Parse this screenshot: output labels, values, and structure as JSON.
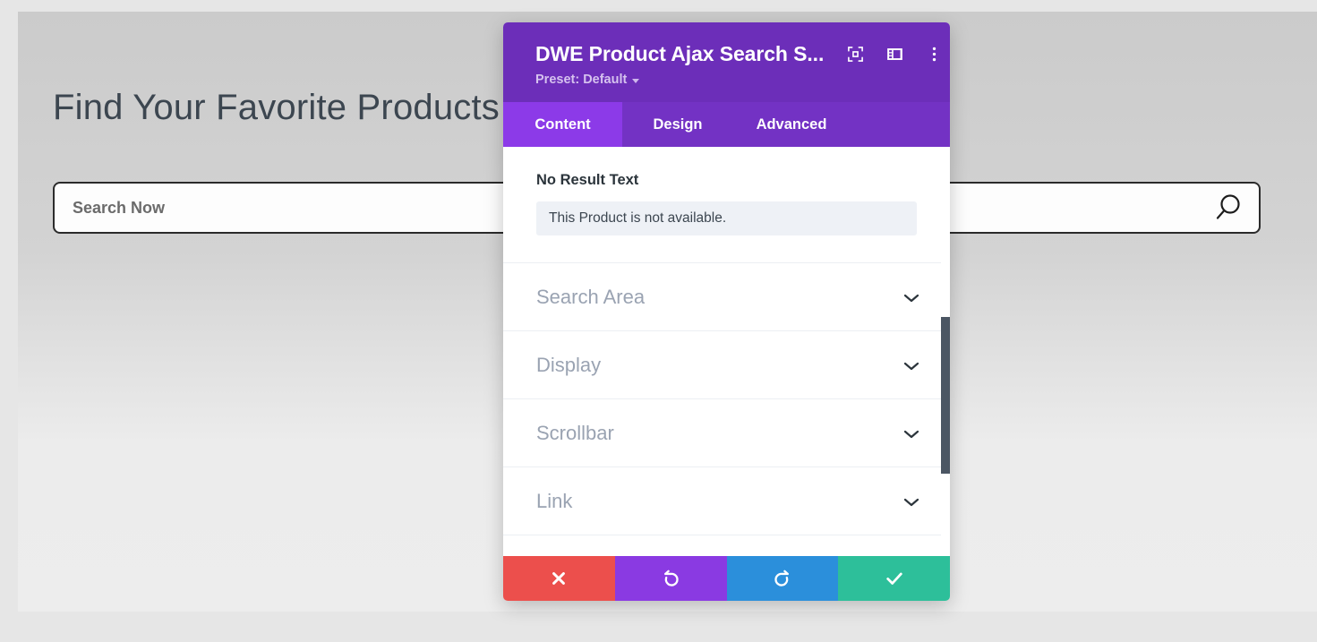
{
  "page": {
    "heading": "Find Your Favorite Products",
    "search": {
      "placeholder": "Search Now",
      "value": "",
      "icon": "search-icon"
    }
  },
  "modal": {
    "title": "DWE Product Ajax Search S...",
    "preset_label": "Preset: Default",
    "header_icons": [
      {
        "name": "focus-target-icon"
      },
      {
        "name": "layout-panel-icon"
      },
      {
        "name": "more-vertical-icon"
      }
    ],
    "tabs": [
      {
        "label": "Content",
        "active": true
      },
      {
        "label": "Design",
        "active": false
      },
      {
        "label": "Advanced",
        "active": false
      }
    ],
    "field": {
      "label": "No Result Text",
      "value": "This Product is not available.",
      "placeholder": ""
    },
    "sections": [
      {
        "label": "Search Area",
        "expanded": false,
        "icon": "chevron-down-icon"
      },
      {
        "label": "Display",
        "expanded": false,
        "icon": "chevron-down-icon"
      },
      {
        "label": "Scrollbar",
        "expanded": false,
        "icon": "chevron-down-icon"
      },
      {
        "label": "Link",
        "expanded": false,
        "icon": "chevron-down-icon"
      }
    ],
    "footer_buttons": [
      {
        "name": "cancel-button",
        "icon": "close-x-icon",
        "color": "#ec4f4c"
      },
      {
        "name": "undo-button",
        "icon": "undo-arrow-icon",
        "color": "#8a3ae2"
      },
      {
        "name": "redo-button",
        "icon": "redo-arrow-icon",
        "color": "#2b8fdb"
      },
      {
        "name": "save-button",
        "icon": "check-icon",
        "color": "#2dbf9a"
      }
    ],
    "colors": {
      "header_purple": "#6c2eb9",
      "tabbar_purple": "#7332c4",
      "active_tab_purple": "#8c3ae8",
      "field_bg": "#eef1f6",
      "section_label": "#9aa3b2",
      "scrollbar_thumb": "#4b5663"
    }
  }
}
